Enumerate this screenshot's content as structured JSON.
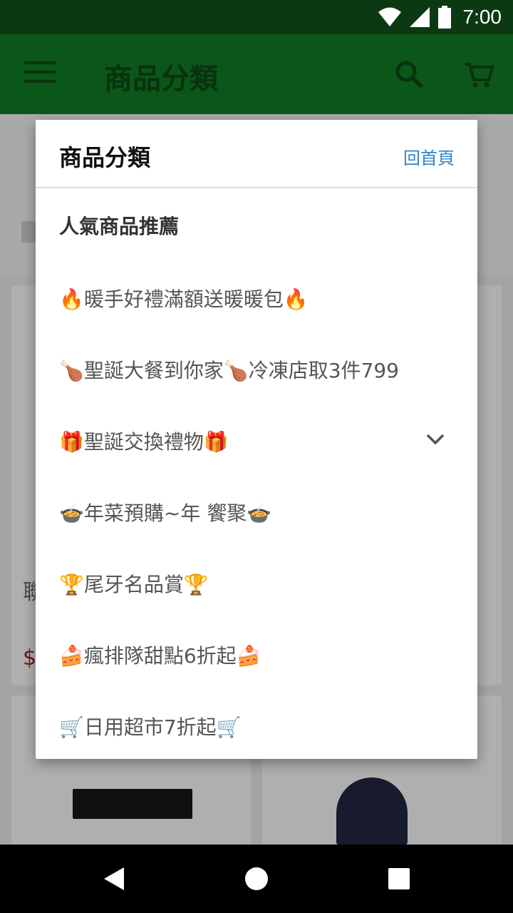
{
  "status_bar": {
    "time": "7:00",
    "icons": [
      "wifi-icon",
      "cellular-signal-icon",
      "battery-icon"
    ]
  },
  "app_bar": {
    "title": "商品分類",
    "icons": [
      "menu-icon",
      "search-icon",
      "cart-icon"
    ]
  },
  "background": {
    "snippet_left": "聯",
    "price_left": "$"
  },
  "dialog": {
    "title": "商品分類",
    "home_link": "回首頁",
    "section_title": "人氣商品推薦",
    "items": [
      {
        "label": "🔥暖手好禮滿額送暖暖包🔥"
      },
      {
        "label": "🍗聖誕大餐到你家🍗冷凍店取3件799"
      },
      {
        "label": "🎁聖誕交換禮物🎁",
        "expandable": true
      },
      {
        "label": "🍲年菜預購~年 饗聚🍲"
      },
      {
        "label": "🏆尾牙名品賞🏆"
      },
      {
        "label": "🍰瘋排隊甜點6折起🍰"
      },
      {
        "label": "🛒日用超市7折起🛒"
      }
    ]
  },
  "colors": {
    "primary": "#0e6a1f",
    "status_bar": "#0b3a12",
    "link": "#2f87c9"
  },
  "nav_bar": {
    "icons": [
      "back-icon",
      "home-icon",
      "recents-icon"
    ]
  }
}
